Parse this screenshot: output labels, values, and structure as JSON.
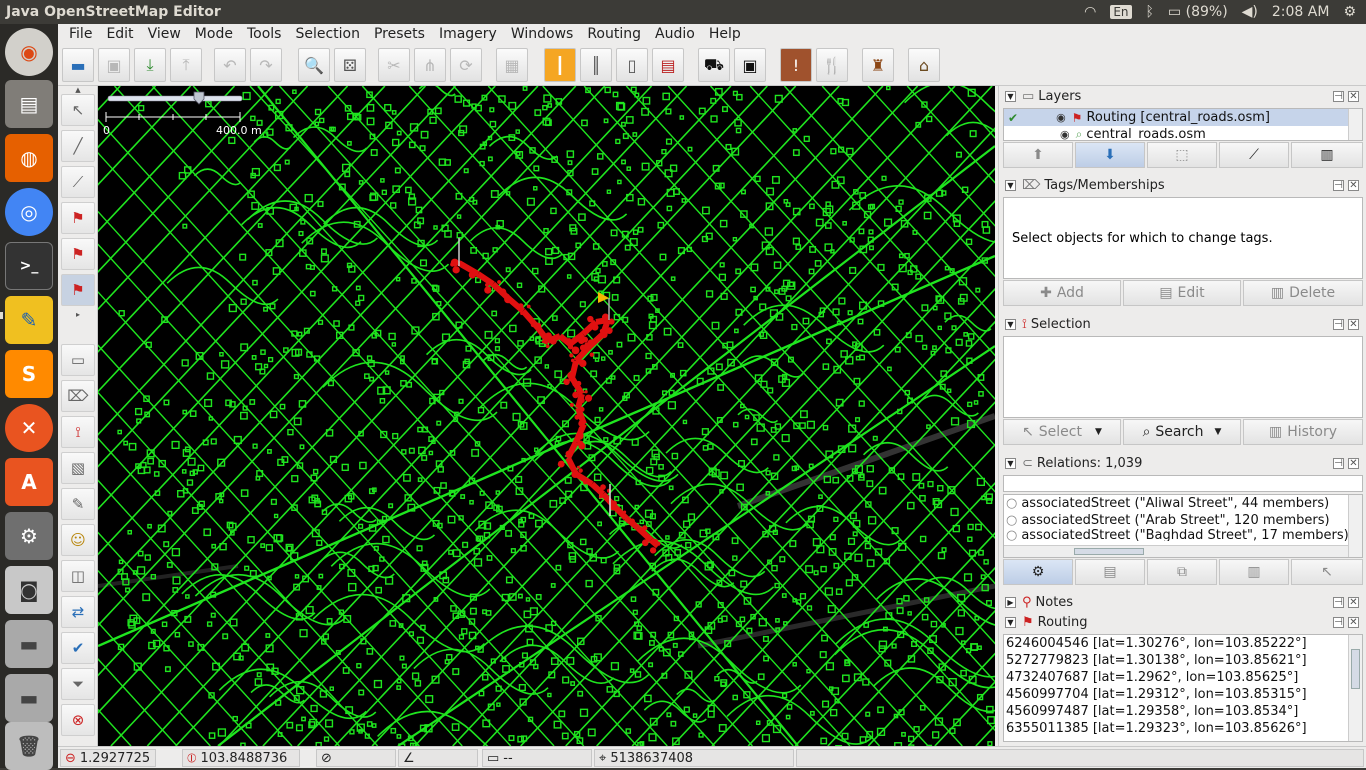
{
  "window": {
    "title": "Java OpenStreetMap Editor"
  },
  "tray": {
    "lang": "En",
    "battery": "(89%)",
    "clock": "2:08 AM"
  },
  "menu": [
    "File",
    "Edit",
    "View",
    "Mode",
    "Tools",
    "Selection",
    "Presets",
    "Imagery",
    "Windows",
    "Routing",
    "Audio",
    "Help"
  ],
  "map": {
    "scale_zero": "0",
    "scale_label": "400.0 m"
  },
  "layers": {
    "title": "Layers",
    "items": [
      {
        "name": "Routing [central_roads.osm]",
        "selected": true
      },
      {
        "name": "central_roads.osm",
        "selected": false
      }
    ]
  },
  "tags": {
    "title": "Tags/Memberships",
    "empty_message": "Select objects for which to change tags.",
    "add_label": "Add",
    "edit_label": "Edit",
    "delete_label": "Delete"
  },
  "selection": {
    "title": "Selection",
    "select_label": "Select",
    "search_label": "Search",
    "history_label": "History"
  },
  "relations": {
    "title": "Relations: 1,039",
    "items": [
      "associatedStreet (\"Aliwal Street\", 44 members)",
      "associatedStreet (\"Arab Street\", 120 members)",
      "associatedStreet (\"Baghdad Street\", 17 members)"
    ]
  },
  "notes": {
    "title": "Notes"
  },
  "routing": {
    "title": "Routing",
    "nodes": [
      "6246004546 [lat=1.30276°, lon=103.85222°]",
      "5272779823 [lat=1.30138°, lon=103.85621°]",
      "4732407687 [lat=1.2962°, lon=103.85625°]",
      "4560997704 [lat=1.29312°, lon=103.85315°]",
      "4560997487 [lat=1.29358°, lon=103.8534°]",
      "6355011385 [lat=1.29323°, lon=103.85626°]"
    ]
  },
  "status": {
    "lat": "1.2927725",
    "lon": "103.8488736",
    "dist": "--",
    "osm_id": "5138637408"
  },
  "colors": {
    "network": "#1fe51f",
    "route": "#e01010",
    "map_bg": "#000000"
  }
}
